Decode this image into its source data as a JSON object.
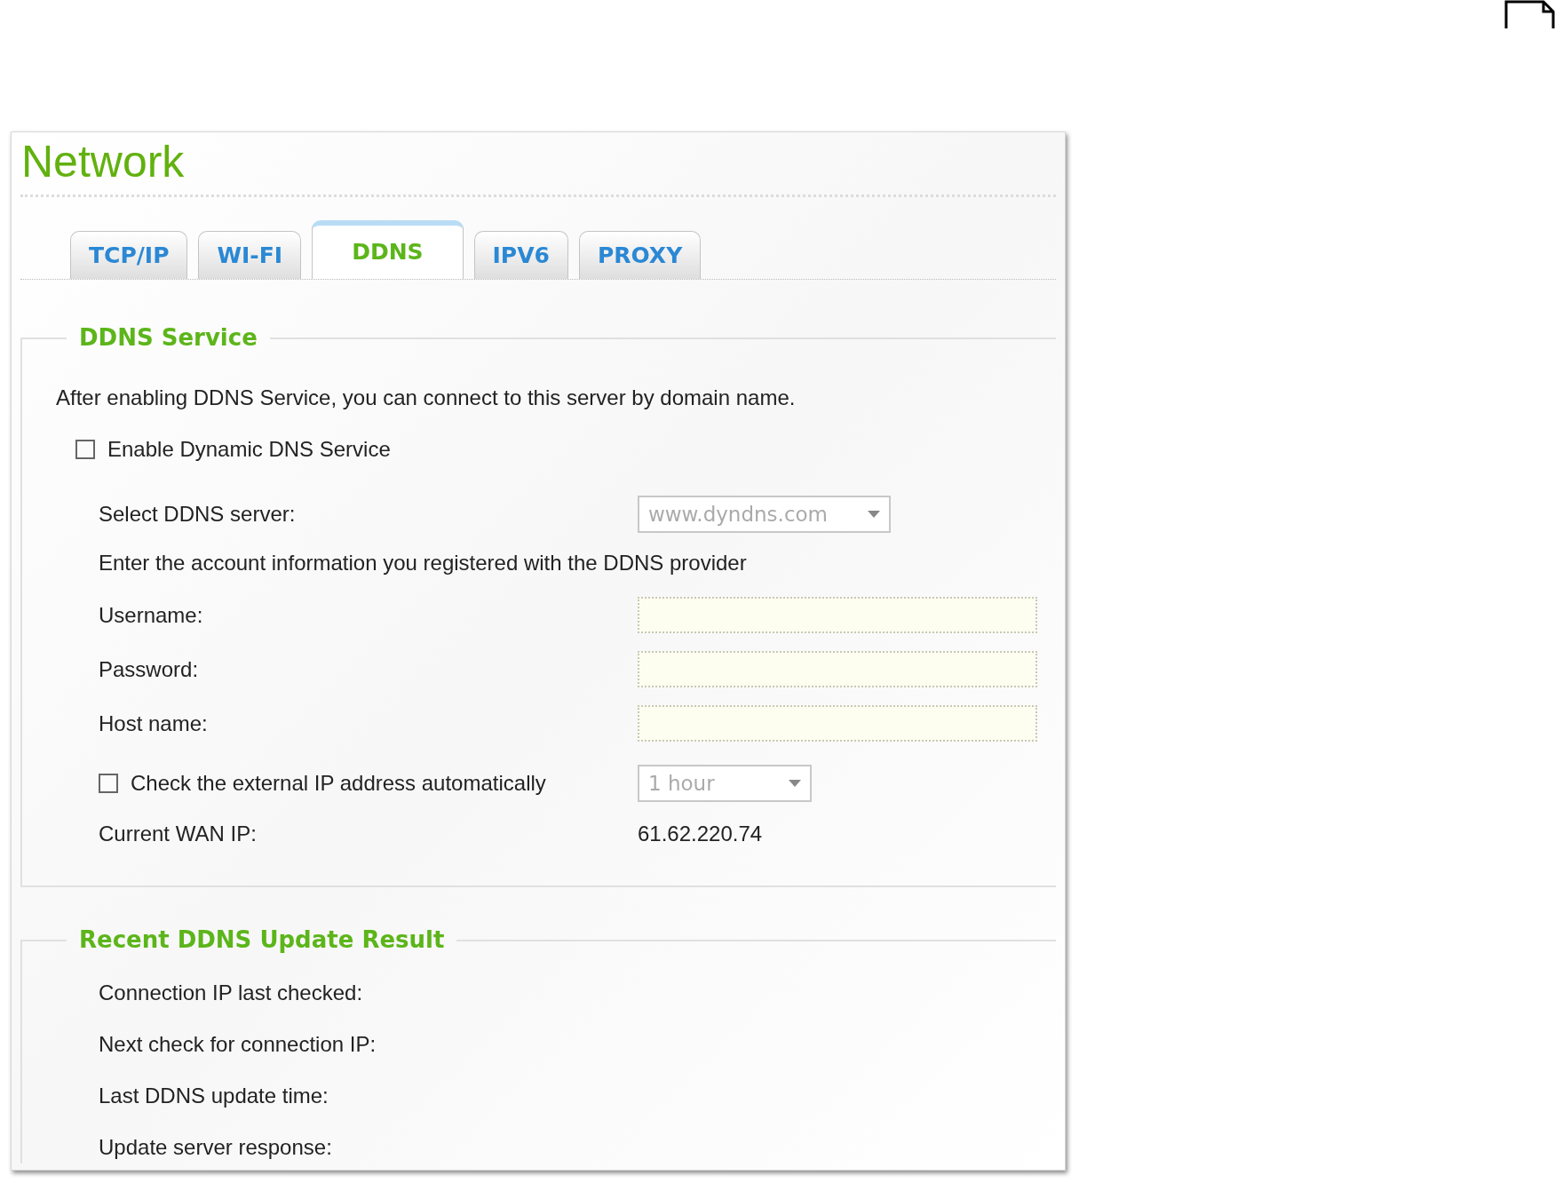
{
  "title": "Network",
  "tabs": [
    {
      "label": "TCP/IP",
      "selected": false
    },
    {
      "label": "WI-FI",
      "selected": false
    },
    {
      "label": "DDNS",
      "selected": true
    },
    {
      "label": "IPV6",
      "selected": false
    },
    {
      "label": "PROXY",
      "selected": false
    }
  ],
  "ddns_service": {
    "title": "DDNS Service",
    "description": "After enabling DDNS Service, you can connect to this server by domain name.",
    "enable": {
      "label": "Enable Dynamic DNS Service",
      "checked": false
    },
    "server": {
      "label": "Select DDNS server:",
      "value": "www.dyndns.com"
    },
    "account_info": "Enter the account information you registered with the DDNS provider",
    "fields": [
      {
        "label": "Username:"
      },
      {
        "label": "Password:"
      },
      {
        "label": "Host name:"
      }
    ],
    "auto_check": {
      "label": "Check the external IP address automatically",
      "checked": false,
      "interval": "1 hour"
    },
    "wan_ip": {
      "label": "Current WAN IP:",
      "value": "61.62.220.74"
    }
  },
  "recent_result": {
    "title": "Recent DDNS Update Result",
    "rows": [
      {
        "label": "Connection IP last checked:"
      },
      {
        "label": "Next check for connection IP:"
      },
      {
        "label": "Last DDNS update time:"
      },
      {
        "label": "Update server response:"
      }
    ]
  }
}
